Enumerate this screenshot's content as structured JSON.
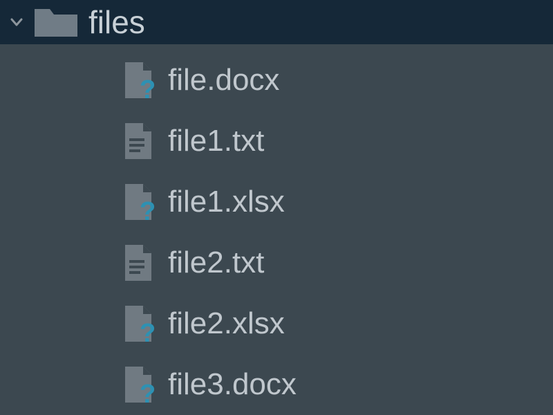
{
  "folder": {
    "name": "files",
    "expanded": true
  },
  "files": [
    {
      "name": "file.docx",
      "icon": "unknown"
    },
    {
      "name": "file1.txt",
      "icon": "text"
    },
    {
      "name": "file1.xlsx",
      "icon": "unknown"
    },
    {
      "name": "file2.txt",
      "icon": "text"
    },
    {
      "name": "file2.xlsx",
      "icon": "unknown"
    },
    {
      "name": "file3.docx",
      "icon": "unknown"
    }
  ],
  "colors": {
    "header_bg": "#152838",
    "panel_bg": "#3c4850",
    "text": "#c8d0d6",
    "icon_fill": "#707a82",
    "accent_question": "#2d91b3"
  }
}
